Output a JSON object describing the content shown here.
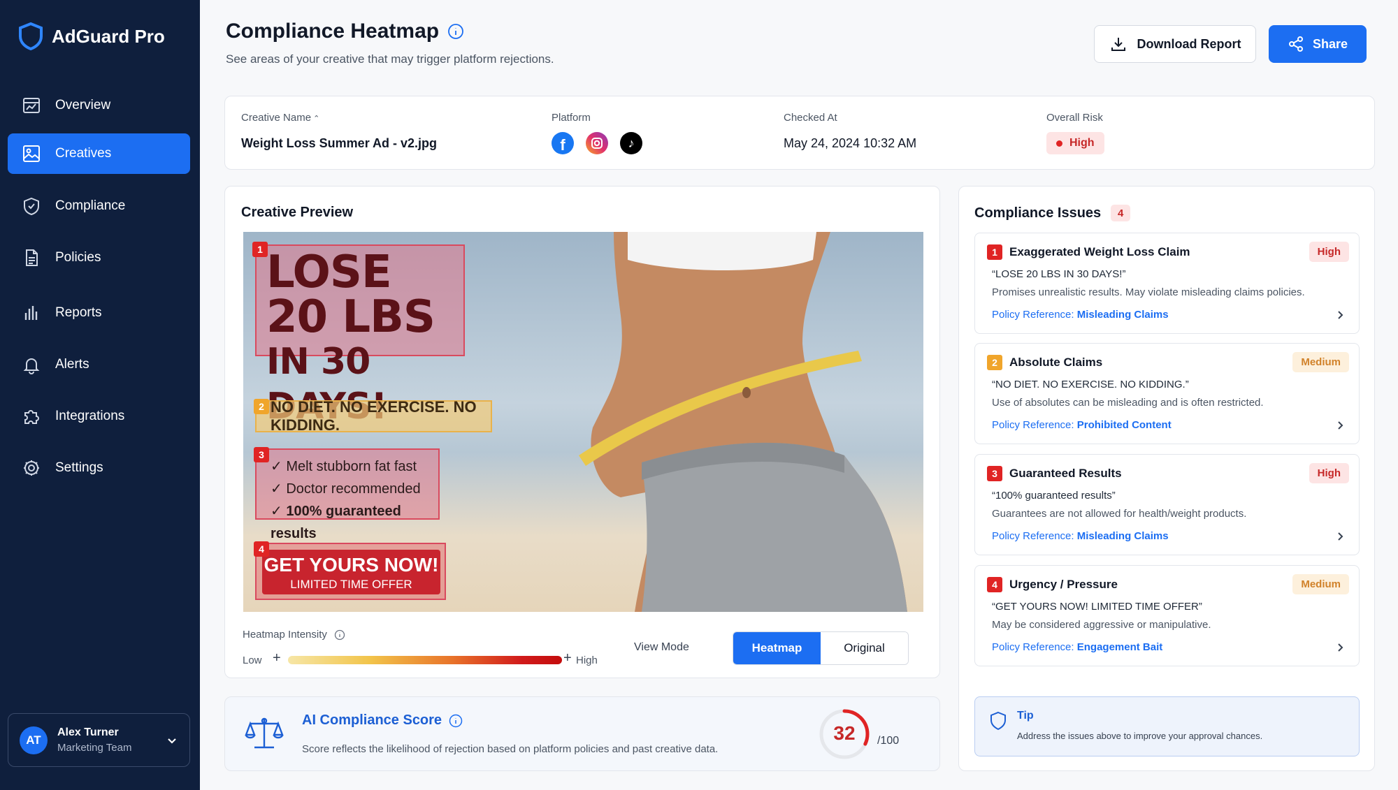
{
  "app": {
    "name": "AdGuard Pro"
  },
  "sidebar": {
    "items": [
      {
        "label": "Overview",
        "icon": "overview-icon"
      },
      {
        "label": "Creatives",
        "icon": "creatives-icon",
        "active": true
      },
      {
        "label": "Compliance",
        "icon": "shield-check-icon"
      },
      {
        "label": "Policies",
        "icon": "document-icon"
      },
      {
        "label": "Reports",
        "icon": "bar-chart-icon"
      },
      {
        "label": "Alerts",
        "icon": "bell-icon"
      },
      {
        "label": "Integrations",
        "icon": "puzzle-icon"
      },
      {
        "label": "Settings",
        "icon": "gear-icon"
      }
    ],
    "user": {
      "initials": "AT",
      "name": "Alex Turner",
      "team": "Marketing Team"
    }
  },
  "header": {
    "title": "Compliance Heatmap",
    "subtitle": "See areas of your creative that may trigger platform rejections.",
    "download_label": "Download Report",
    "share_label": "Share"
  },
  "info": {
    "creative_name_label": "Creative Name",
    "creative_name": "Weight Loss Summer Ad - v2.jpg",
    "platform_label": "Platform",
    "platforms": [
      "facebook-icon",
      "instagram-icon",
      "tiktok-icon"
    ],
    "checked_at_label": "Checked At",
    "checked_at": "May 24, 2024  10:32 AM",
    "overall_risk_label": "Overall Risk",
    "overall_risk": "High"
  },
  "preview": {
    "title": "Creative Preview",
    "zones": [
      {
        "num": "1",
        "lines": [
          "LOSE",
          "20 LBS",
          "IN 30 DAYS!"
        ]
      },
      {
        "num": "2",
        "text": "NO DIET. NO EXERCISE. NO KIDDING."
      },
      {
        "num": "3",
        "lines": [
          "Melt stubborn fat fast",
          "Doctor recommended",
          "100% guaranteed results"
        ]
      },
      {
        "num": "4",
        "cta_main": "GET YOURS NOW!",
        "cta_sub": "LIMITED TIME OFFER"
      }
    ],
    "heatmap_label": "Heatmap Intensity",
    "low_label": "Low",
    "high_label": "High",
    "view_mode_label": "View Mode",
    "view_heatmap": "Heatmap",
    "view_original": "Original",
    "active_view": "Heatmap"
  },
  "score": {
    "title": "AI Compliance Score",
    "description": "Score reflects the likelihood of rejection based on platform policies and past creative data.",
    "value": "32",
    "max_label": "/100",
    "fraction": 0.32
  },
  "issues": {
    "title": "Compliance Issues",
    "count": "4",
    "items": [
      {
        "num": "1",
        "title": "Exaggerated Weight Loss Claim",
        "severity": "High",
        "quote": "“LOSE 20 LBS IN 30 DAYS!”",
        "desc": "Promises unrealistic results. May violate misleading claims policies.",
        "ref_label": "Policy Reference: ",
        "ref_value": "Misleading Claims"
      },
      {
        "num": "2",
        "title": "Absolute Claims",
        "severity": "Medium",
        "quote": "“NO DIET. NO EXERCISE.  NO KIDDING.”",
        "desc": "Use of absolutes can be misleading and is often restricted.",
        "ref_label": "Policy Reference: ",
        "ref_value": "Prohibited Content"
      },
      {
        "num": "3",
        "title": "Guaranteed Results",
        "severity": "High",
        "quote": "“100% guaranteed results”",
        "desc": "Guarantees are not allowed for health/weight products.",
        "ref_label": "Policy Reference: ",
        "ref_value": "Misleading Claims"
      },
      {
        "num": "4",
        "title": "Urgency / Pressure",
        "severity": "Medium",
        "quote": "“GET YOURS NOW! LIMITED TIME OFFER”",
        "desc": "May be considered aggressive or manipulative.",
        "ref_label": "Policy Reference: ",
        "ref_value": "Engagement Bait"
      }
    ],
    "tip_title": "Tip",
    "tip_text": "Address the issues above to improve your approval chances."
  },
  "colors": {
    "primary": "#1c6ef2",
    "sidebar": "#0f1f3d",
    "high": "#e02424",
    "medium": "#f0a52b"
  }
}
